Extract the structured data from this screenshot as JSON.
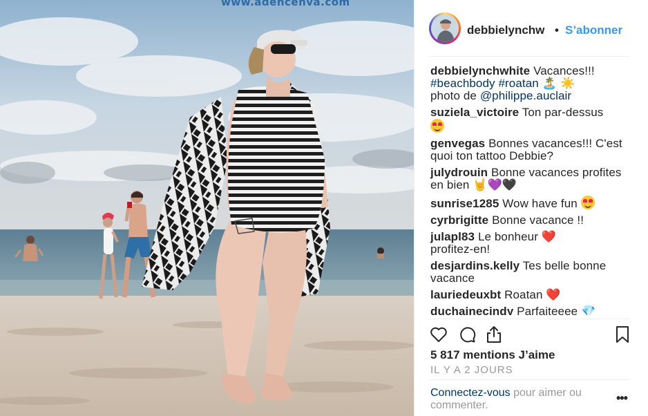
{
  "photo": {
    "watermark": "www.adencenva.com"
  },
  "post": {
    "author": "debbielynchw",
    "separator": "•",
    "follow_label": "S’abonner"
  },
  "caption": {
    "user": "debbielynchwhite",
    "text": "Vacances!!!",
    "tag1": "#beachbody",
    "tag2": "#roatan",
    "emoji": "🏝️ ☀️",
    "photo_by": "photo de",
    "mention": "@philippe.auclair"
  },
  "comments": [
    {
      "user": "suziela_victoire",
      "text": "Ton par-dessus"
    },
    {
      "user": "genvegas",
      "text": "Bonnes vacances!!! C'est quoi ton tattoo Debbie?"
    },
    {
      "user": "julydrouin",
      "text": "Bonne vacances profites en bien",
      "emoji1": "🤘",
      "emoji2": "💜",
      "emoji3": "🖤"
    },
    {
      "user": "sunrise1285",
      "text": "Wow have fun"
    },
    {
      "user": "cyrbrigitte",
      "text": "Bonne vacance !!"
    },
    {
      "user": "julapl83",
      "text": "Le bonheur",
      "emoji": "❤️",
      "text2": "profitez-en!"
    },
    {
      "user": "desjardins.kelly",
      "text": "Tes belle bonne vacance"
    },
    {
      "user": "lauriedeuxbt",
      "text": "Roatan",
      "emoji": "❤️"
    },
    {
      "user": "duchainecindy",
      "text": "Parfaiteeee",
      "emoji": "💎",
      "emoji2": "💎❤️"
    }
  ],
  "icons": {
    "like": "heart-icon",
    "comment": "comment-bubble-icon",
    "share": "share-icon",
    "save": "bookmark-icon"
  },
  "likes_text": "5 817 mentions J’aime",
  "timestamp": "IL Y A 2 JOURS",
  "login": {
    "link": "Connectez-vous",
    "rest": "pour aimer ou commenter."
  },
  "more_label": "•••",
  "colors": {
    "link_blue": "#3897f0",
    "text": "#262626",
    "muted": "#999999",
    "hashtag": "#003569"
  }
}
